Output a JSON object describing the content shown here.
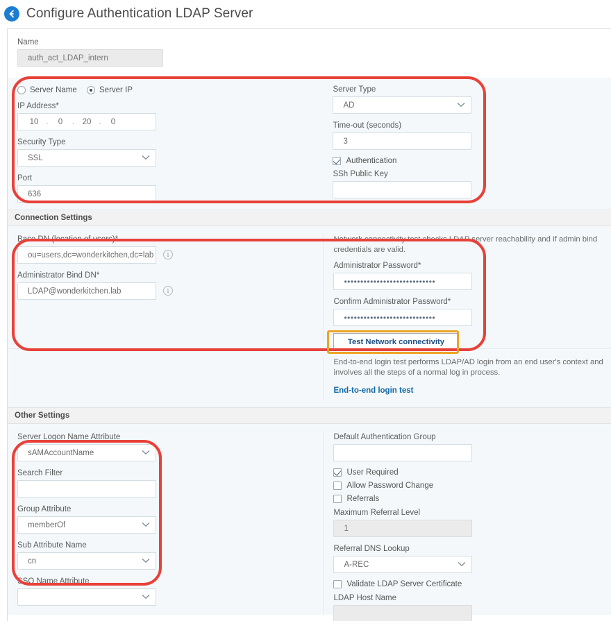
{
  "header": {
    "back_icon": "back-arrow-icon",
    "title": "Configure Authentication LDAP Server"
  },
  "name_field": {
    "label": "Name",
    "value": "auth_act_LDAP_intern"
  },
  "server_section": {
    "radio_server_name": "Server Name",
    "radio_server_ip": "Server IP",
    "selected_radio": "Server IP",
    "ip_address": {
      "label": "IP Address*",
      "octets": [
        "10",
        "0",
        "20",
        "0"
      ],
      "separator": "."
    },
    "security_type": {
      "label": "Security Type",
      "value": "SSL"
    },
    "port": {
      "label": "Port",
      "value": "636"
    },
    "server_type": {
      "label": "Server Type",
      "value": "AD"
    },
    "timeout": {
      "label": "Time-out (seconds)",
      "value": "3"
    },
    "authentication": {
      "label": "Authentication",
      "checked": true
    },
    "ssh_public_key": {
      "label": "SSh Public Key",
      "value": ""
    }
  },
  "connection_settings": {
    "section_title": "Connection Settings",
    "base_dn": {
      "label": "Base DN (location of users)*",
      "value": "ou=users,dc=wonderkitchen,dc=lab",
      "info_icon": "info-icon"
    },
    "admin_bind_dn": {
      "label": "Administrator Bind DN*",
      "value": "LDAP@wonderkitchen.lab",
      "info_icon": "info-icon"
    },
    "network_note": "Network connectivity test checks LDAP server reachability and if admin bind credentials are valid.",
    "admin_password": {
      "label": "Administrator Password*",
      "value": "••••••••••••••••••••••••••••"
    },
    "confirm_admin_password": {
      "label": "Confirm Administrator Password*",
      "value": "••••••••••••••••••••••••••••"
    },
    "test_network_button": "Test Network connectivity",
    "e2e_note": "End-to-end login test performs LDAP/AD login from an end user's context and involves all the steps of a normal log in process.",
    "e2e_link": "End-to-end login test"
  },
  "other_settings": {
    "section_title": "Other Settings",
    "server_logon_name_attribute": {
      "label": "Server Logon Name Attribute",
      "value": "sAMAccountName"
    },
    "search_filter": {
      "label": "Search Filter",
      "value": ""
    },
    "group_attribute": {
      "label": "Group Attribute",
      "value": "memberOf"
    },
    "sub_attribute_name": {
      "label": "Sub Attribute Name",
      "value": "cn"
    },
    "sso_name_attribute": {
      "label": "SSO Name Attribute",
      "value": ""
    },
    "default_authentication_group": {
      "label": "Default Authentication Group",
      "value": ""
    },
    "user_required": {
      "label": "User Required",
      "checked": true
    },
    "allow_password_change": {
      "label": "Allow Password Change",
      "checked": false
    },
    "referrals": {
      "label": "Referrals",
      "checked": false
    },
    "maximum_referral_level": {
      "label": "Maximum Referral Level",
      "value": "1"
    },
    "referral_dns_lookup": {
      "label": "Referral DNS Lookup",
      "value": "A-REC"
    },
    "validate_ldap_server_certificate": {
      "label": "Validate LDAP Server Certificate",
      "checked": false
    },
    "ldap_host_name": {
      "label": "LDAP Host Name",
      "value": ""
    }
  },
  "colors": {
    "accent_blue": "#1b7dd1",
    "link_blue": "#1368a8",
    "annotation_red": "#e8413a",
    "annotation_amber": "#eca427"
  }
}
